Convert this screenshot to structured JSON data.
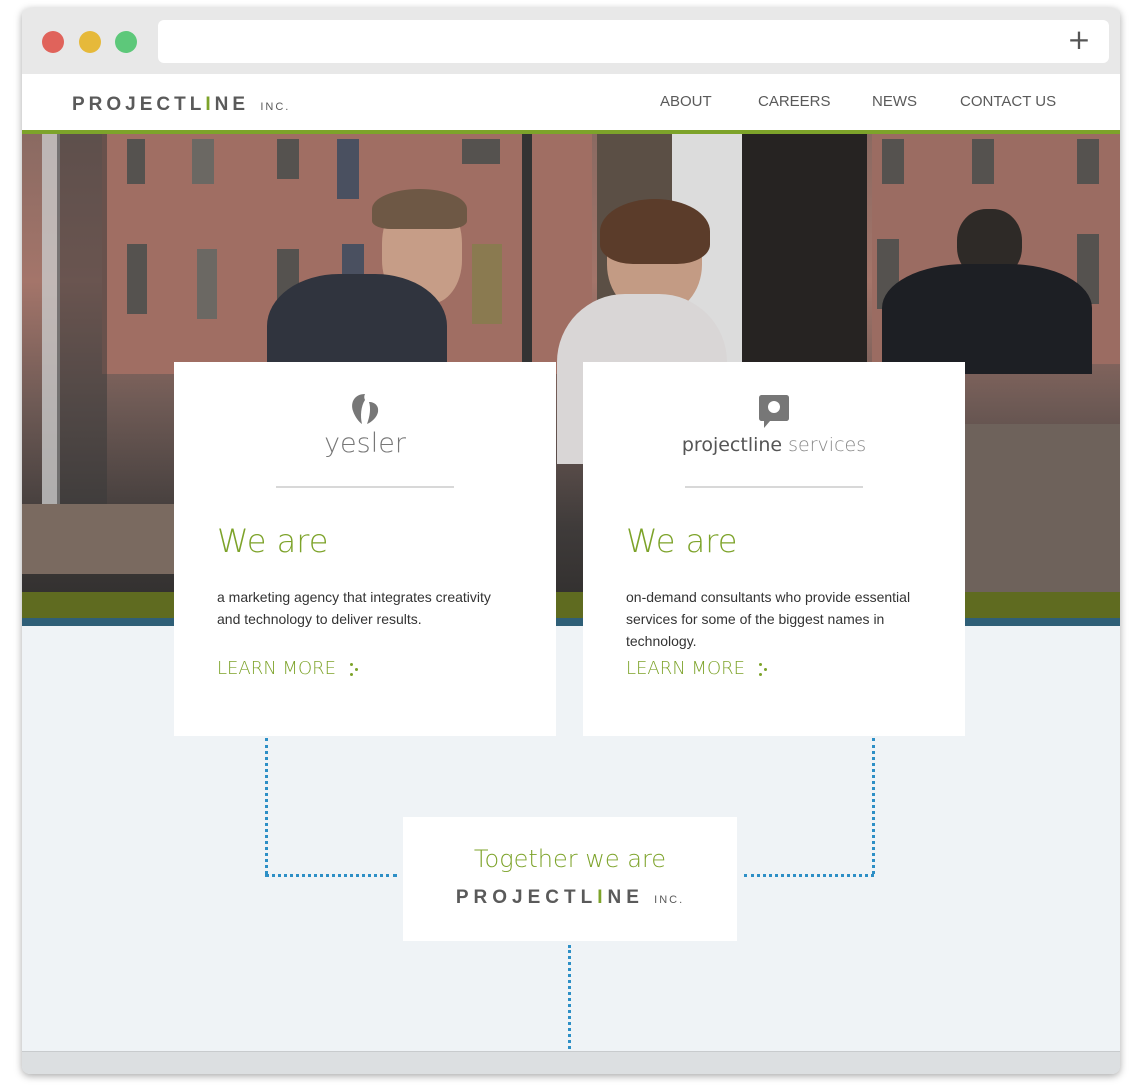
{
  "browser": {
    "new_tab_symbol": "+"
  },
  "header": {
    "logo": {
      "part1": "PROJECTL",
      "highlight": "I",
      "part2": "NE",
      "inc": "INC."
    },
    "nav": [
      "ABOUT",
      "CAREERS",
      "NEWS",
      "CONTACT US"
    ]
  },
  "cards": [
    {
      "brand": "yesler",
      "brand_icon": "yesler-leaf-icon",
      "headline": "We are",
      "description": "a marketing agency that integrates creativity and technology to deliver results.",
      "cta": "LEARN MORE"
    },
    {
      "brand": "projectline",
      "brand_suffix": "services",
      "brand_icon": "projectline-p-icon",
      "headline": "We are",
      "description": "on-demand consultants who provide essential services for some of the biggest names in technology.",
      "cta": "LEARN MORE"
    }
  ],
  "together": {
    "line": "Together we are",
    "logo": {
      "part1": "PROJECTL",
      "highlight": "I",
      "part2": "NE",
      "inc": "INC."
    }
  },
  "colors": {
    "accent_green": "#7da32a",
    "connector_blue": "#2d8fc6",
    "page_bg": "#eff3f6"
  }
}
